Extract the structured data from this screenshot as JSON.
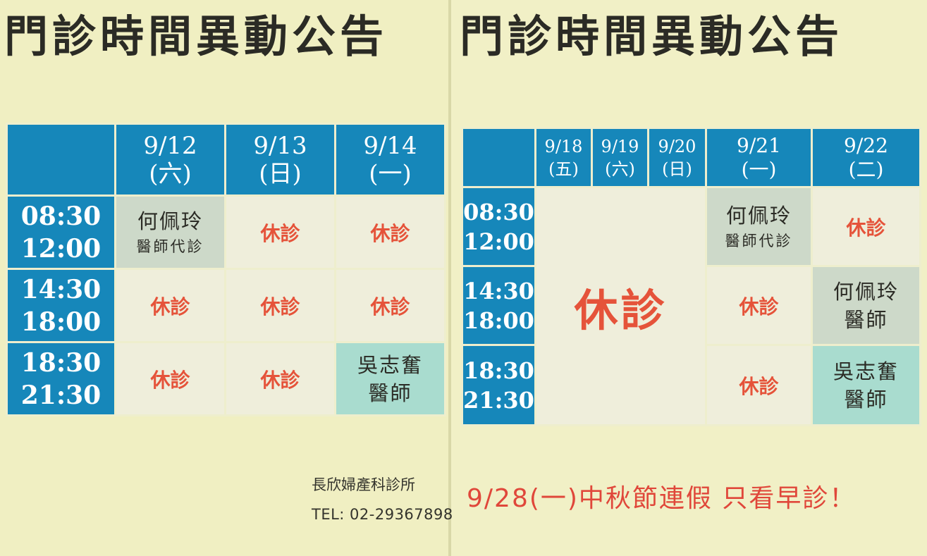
{
  "notice": {
    "title_left": "門診時間異動公告",
    "title_right": "門診時間異動公告"
  },
  "left_table": {
    "dates": [
      {
        "date": "9/12",
        "weekday": "(六)"
      },
      {
        "date": "9/13",
        "weekday": "(日)"
      },
      {
        "date": "9/14",
        "weekday": "(一)"
      }
    ],
    "rows": [
      {
        "start": "08:30",
        "end": "12:00",
        "cells": [
          {
            "name": "何佩玲",
            "role": "醫師代診"
          },
          {
            "closed": "休診"
          },
          {
            "closed": "休診"
          }
        ]
      },
      {
        "start": "14:30",
        "end": "18:00",
        "cells": [
          {
            "closed": "休診"
          },
          {
            "closed": "休診"
          },
          {
            "closed": "休診"
          }
        ]
      },
      {
        "start": "18:30",
        "end": "21:30",
        "cells": [
          {
            "closed": "休診"
          },
          {
            "closed": "休診"
          },
          {
            "name": "吳志奮",
            "role": "醫師"
          }
        ]
      }
    ]
  },
  "right_table": {
    "dates": [
      {
        "date": "9/18",
        "weekday": "(五)"
      },
      {
        "date": "9/19",
        "weekday": "(六)"
      },
      {
        "date": "9/20",
        "weekday": "(日)"
      },
      {
        "date": "9/21",
        "weekday": "(一)"
      },
      {
        "date": "9/22",
        "weekday": "(二)"
      }
    ],
    "times": [
      {
        "start": "08:30",
        "end": "12:00"
      },
      {
        "start": "14:30",
        "end": "18:00"
      },
      {
        "start": "18:30",
        "end": "21:30"
      }
    ],
    "merged_closed": "休診",
    "d21": [
      {
        "name": "何佩玲",
        "role": "醫師代診"
      },
      {
        "closed": "休診"
      },
      {
        "closed": "休診"
      }
    ],
    "d22": [
      {
        "closed": "休診"
      },
      {
        "name": "何佩玲",
        "role": "醫師"
      },
      {
        "name": "吳志奮",
        "role": "醫師"
      }
    ]
  },
  "footer": {
    "clinic_name": "長欣婦產科診所",
    "tel": "TEL: 02-29367898",
    "holiday_notice": "9/28(一)中秋節連假 只看早診！"
  },
  "colors": {
    "header_blue": "#1687ba",
    "closed_red": "#e5533a",
    "doctor_grey": "#cdd9c9",
    "doctor_teal": "#a9dccf",
    "paper": "#f0efc2"
  }
}
